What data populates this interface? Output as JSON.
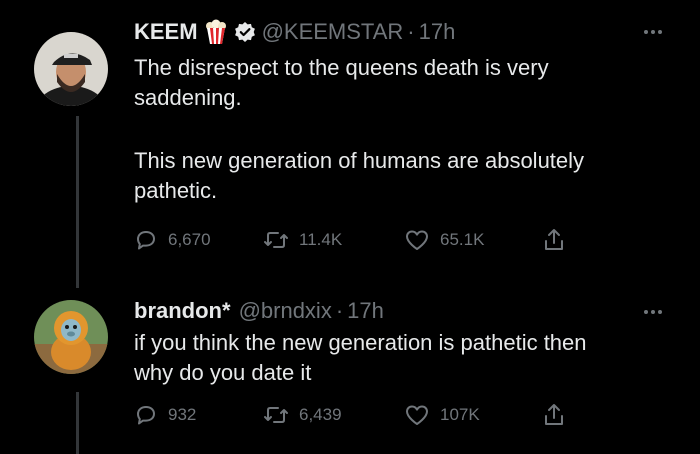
{
  "tweets": [
    {
      "display_name": "KEEM",
      "emoji_icon": "popcorn-icon",
      "verified": true,
      "handle": "@KEEMSTAR",
      "dot": "·",
      "time": "17h",
      "text_lines": [
        "The disrespect to the queens death is very",
        "saddening.",
        "",
        "This new generation of humans are absolutely",
        "pathetic."
      ],
      "reply_count": "6,670",
      "retweet_count": "11.4K",
      "like_count": "65.1K"
    },
    {
      "display_name": "brandon*",
      "handle": "@brndxix",
      "dot": "·",
      "time": "17h",
      "text_lines": [
        "if you think the new generation is pathetic then",
        "why do you date it"
      ],
      "reply_count": "932",
      "retweet_count": "6,439",
      "like_count": "107K"
    }
  ],
  "colors": {
    "background": "#000000",
    "text": "#e7e9ea",
    "muted": "#71767b",
    "thread_line": "#333639"
  }
}
